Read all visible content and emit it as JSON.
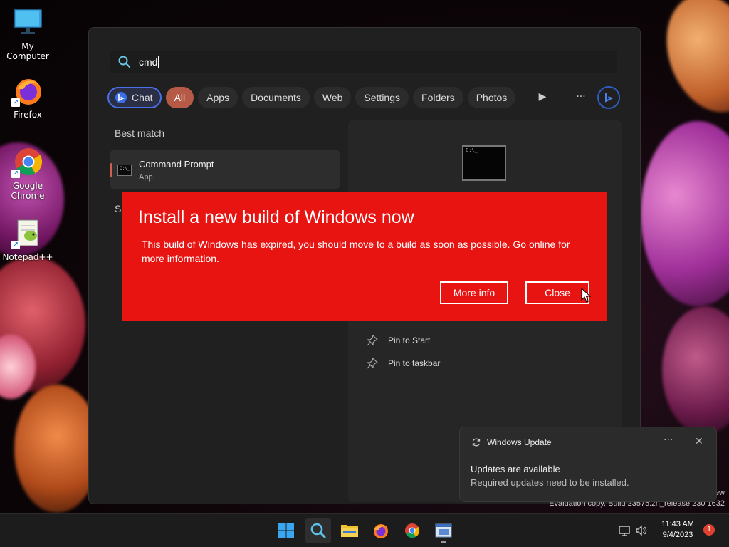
{
  "desktop": {
    "icons": [
      {
        "label": "My Computer"
      },
      {
        "label": "Firefox"
      },
      {
        "label": "Google Chrome"
      },
      {
        "label": "Notepad++"
      }
    ]
  },
  "search": {
    "query": "cmd",
    "filters": {
      "chat": "Chat",
      "all": "All",
      "apps": "Apps",
      "documents": "Documents",
      "web": "Web",
      "settings": "Settings",
      "folders": "Folders",
      "photos": "Photos"
    },
    "best_match_label": "Best match",
    "settings_section_label_partial": "Se",
    "best_match": {
      "name": "Command Prompt",
      "type": "App"
    },
    "actions": {
      "pin_start": "Pin to Start",
      "pin_taskbar": "Pin to taskbar"
    }
  },
  "dialog": {
    "title": "Install a new build of Windows now",
    "body": "This build of Windows has expired, you should move to a build as soon as possible. Go online for more information.",
    "more_info": "More info",
    "close": "Close",
    "color": "#e81412"
  },
  "toast": {
    "app": "Windows Update",
    "more": "···",
    "close": "✕",
    "title": "Updates are available",
    "message": "Required updates need to be installed."
  },
  "watermark": {
    "line1": "ew",
    "line2": "Evaluation copy. Build 23575.zn_release.230   1632"
  },
  "taskbar": {
    "time": "11:43 AM",
    "date": "9/4/2023",
    "notifications": "1"
  }
}
